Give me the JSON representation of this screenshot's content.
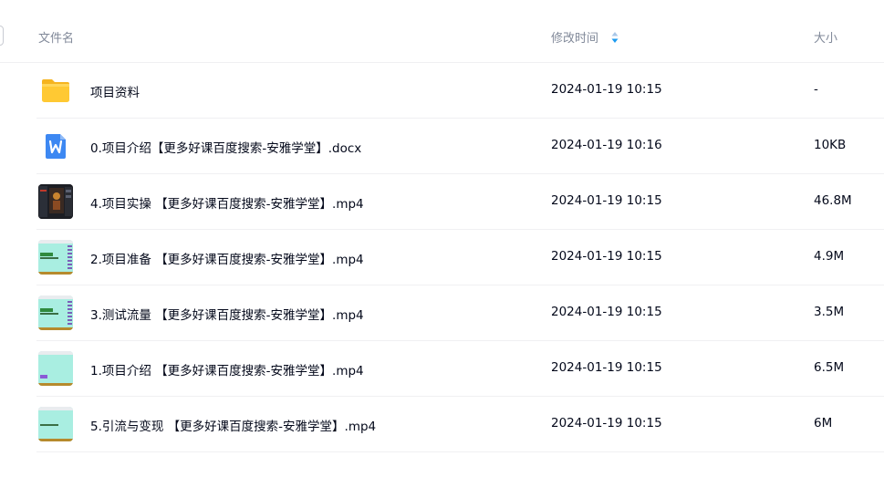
{
  "header": {
    "name": "文件名",
    "time": "修改时间",
    "size": "大小"
  },
  "colors": {
    "sort_up": "#a9c7e8",
    "sort_down": "#1d9bf0",
    "folder": "#ffc933",
    "doc": "#3d88f2"
  },
  "files": [
    {
      "name": "项目资料",
      "time": "2024-01-19 10:15",
      "size": "-",
      "icon": "folder-icon"
    },
    {
      "name": "0.项目介绍【更多好课百度搜索-安雅学堂】.docx",
      "time": "2024-01-19 10:16",
      "size": "10KB",
      "icon": "word-doc-icon"
    },
    {
      "name": "4.项目实操 【更多好课百度搜索-安雅学堂】.mp4",
      "time": "2024-01-19 10:15",
      "size": "46.8M",
      "icon": "video-thumbnail-icon"
    },
    {
      "name": "2.项目准备 【更多好课百度搜索-安雅学堂】.mp4",
      "time": "2024-01-19 10:15",
      "size": "4.9M",
      "icon": "video-thumbnail-icon"
    },
    {
      "name": "3.测试流量 【更多好课百度搜索-安雅学堂】.mp4",
      "time": "2024-01-19 10:15",
      "size": "3.5M",
      "icon": "video-thumbnail-icon"
    },
    {
      "name": "1.项目介绍 【更多好课百度搜索-安雅学堂】.mp4",
      "time": "2024-01-19 10:15",
      "size": "6.5M",
      "icon": "video-thumbnail-icon"
    },
    {
      "name": "5.引流与变现 【更多好课百度搜索-安雅学堂】.mp4",
      "time": "2024-01-19 10:15",
      "size": "6M",
      "icon": "video-thumbnail-icon"
    }
  ]
}
